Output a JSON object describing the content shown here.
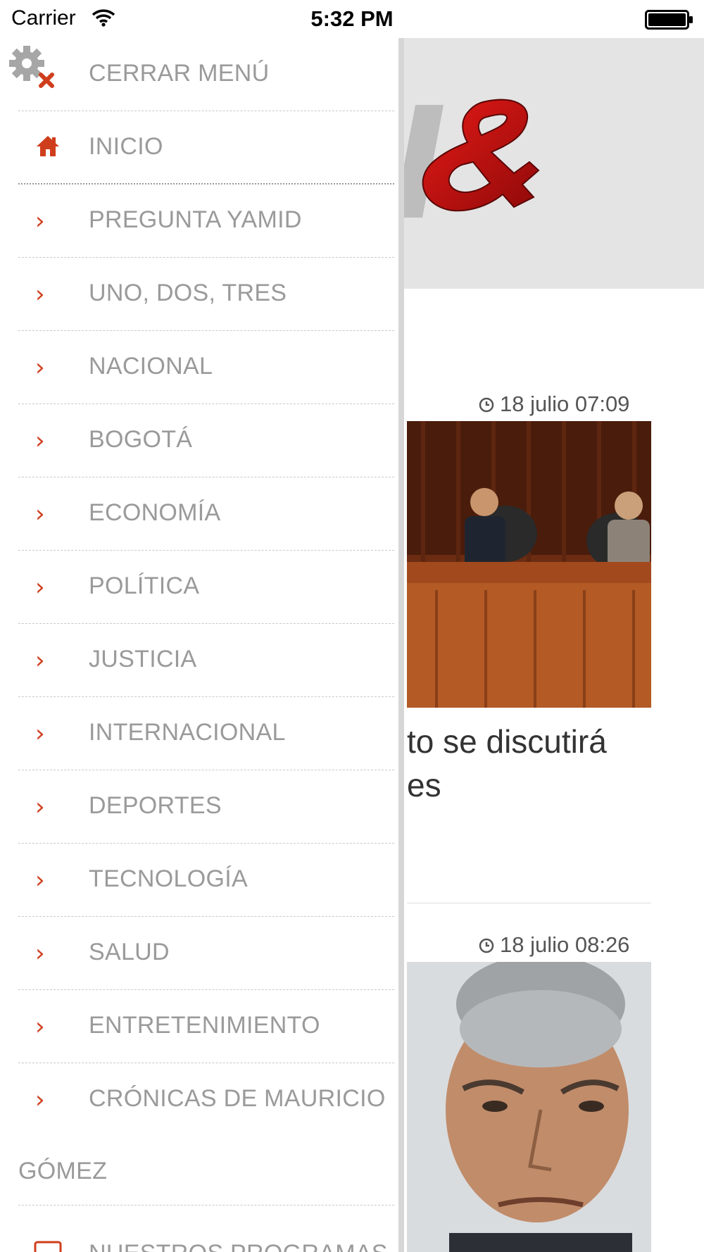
{
  "status_bar": {
    "carrier": "Carrier",
    "time": "5:32 PM"
  },
  "colors": {
    "accent": "#cf3e1c",
    "menu_text": "#9a9a9a",
    "header_bg": "#e4e4e4",
    "logo_red": "#c0100f"
  },
  "menu": {
    "close_label": "CERRAR MENÚ",
    "home_label": "INICIO",
    "items": [
      {
        "label": "PREGUNTA YAMID",
        "icon": "chevron-right-icon"
      },
      {
        "label": "UNO, DOS, TRES",
        "icon": "chevron-right-icon"
      },
      {
        "label": "NACIONAL",
        "icon": "chevron-right-icon"
      },
      {
        "label": "BOGOTÁ",
        "icon": "chevron-right-icon"
      },
      {
        "label": "ECONOMÍA",
        "icon": "chevron-right-icon"
      },
      {
        "label": "POLÍTICA",
        "icon": "chevron-right-icon"
      },
      {
        "label": "JUSTICIA",
        "icon": "chevron-right-icon"
      },
      {
        "label": "INTERNACIONAL",
        "icon": "chevron-right-icon"
      },
      {
        "label": "DEPORTES",
        "icon": "chevron-right-icon"
      },
      {
        "label": "TECNOLOGÍA",
        "icon": "chevron-right-icon"
      },
      {
        "label": "SALUD",
        "icon": "chevron-right-icon"
      },
      {
        "label": "ENTRETENIMIENTO",
        "icon": "chevron-right-icon"
      },
      {
        "label": "CRÓNICAS DE MAURICIO",
        "icon": "chevron-right-icon"
      }
    ],
    "overflow_text": "GÓMEZ",
    "programs_label": "NUESTROS PROGRAMAS"
  },
  "articles": [
    {
      "time": "18 julio 07:09",
      "headline_fragment": "to se discutirá\nes"
    },
    {
      "time": "18 julio 08:26"
    }
  ]
}
